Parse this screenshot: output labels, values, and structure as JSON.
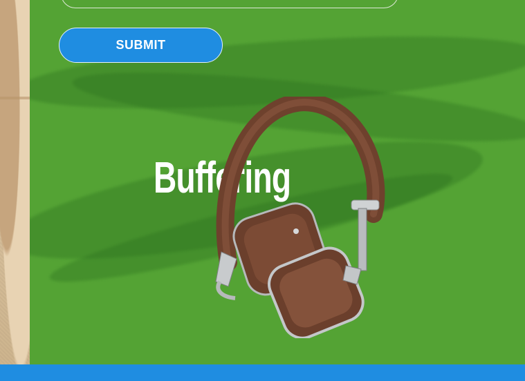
{
  "form": {
    "submit_label": "SUBMIT"
  },
  "hero": {
    "headline": "Buffering",
    "product_image": "headphones-icon"
  },
  "colors": {
    "background_green": "#54a334",
    "accent_blue": "#1f8de1",
    "headphone_brown": "#7b4a34"
  }
}
